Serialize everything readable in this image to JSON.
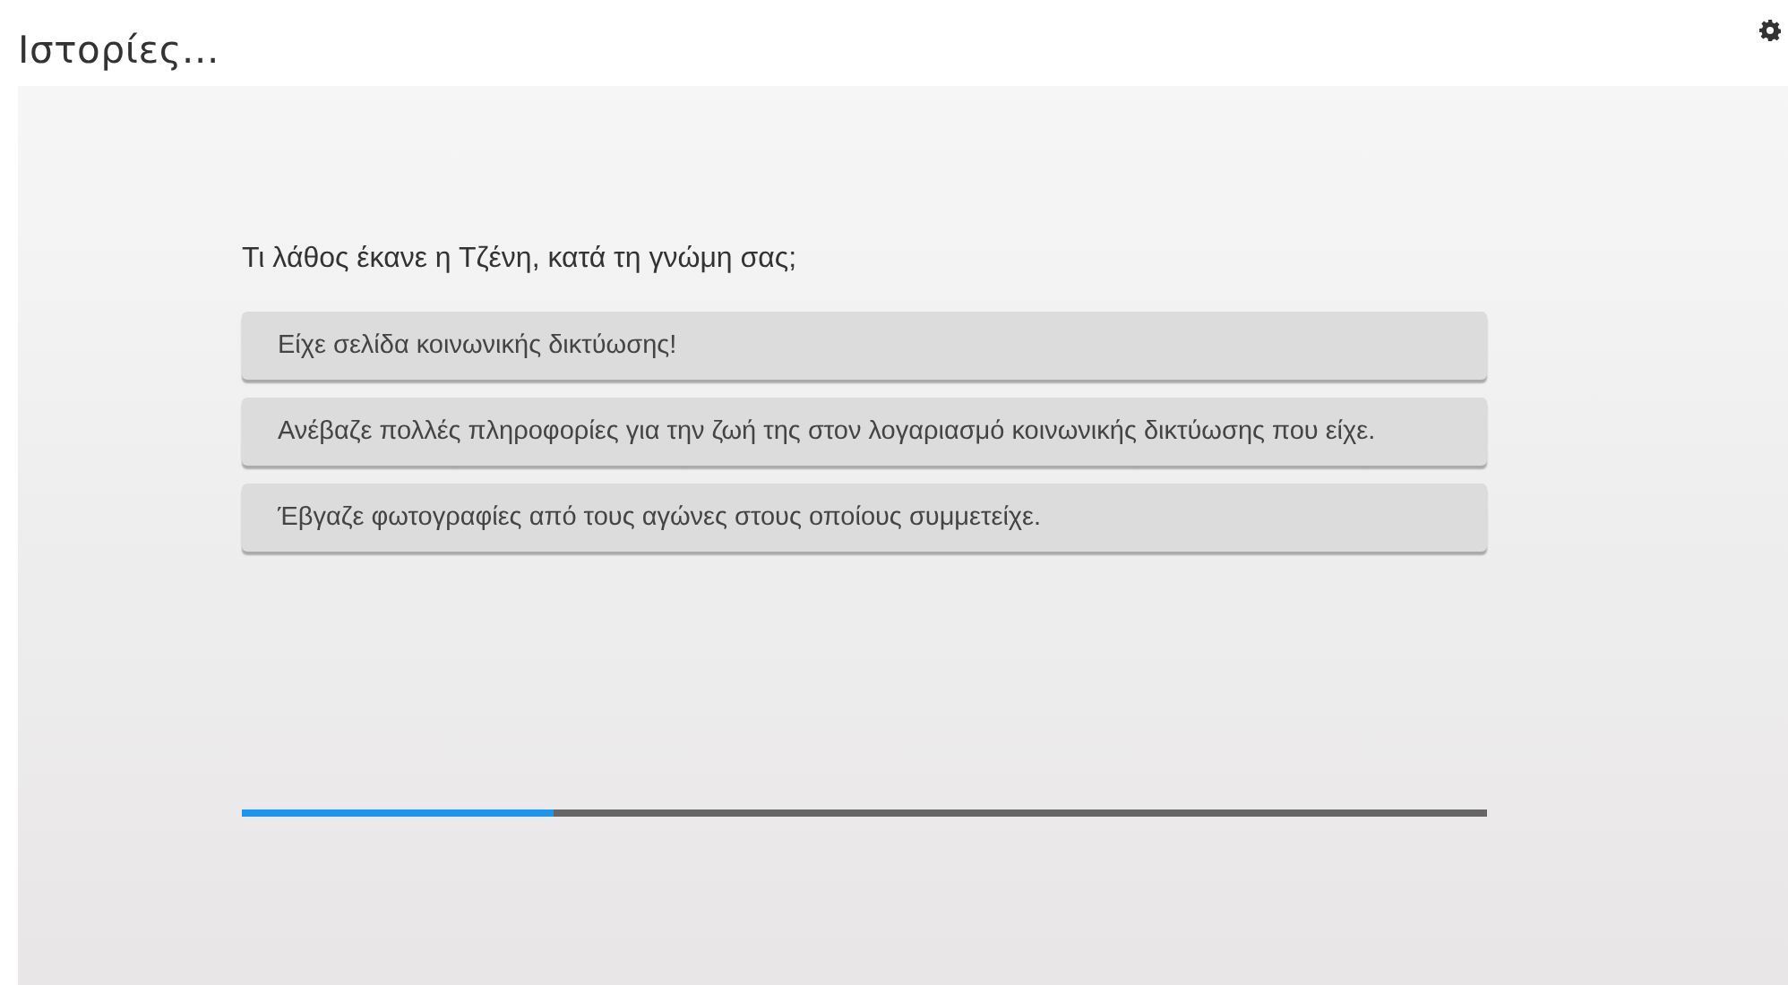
{
  "title": "Ιστορίες...",
  "question": "Τι λάθος έκανε η Τζένη, κατά τη γνώμη σας;",
  "options": [
    {
      "label": "Είχε σελίδα κοινωνικής δικτύωσης!"
    },
    {
      "label": "Ανέβαζε πολλές πληροφορίες για την ζωή της στον λογαριασμό κοινωνικής δικτύωσης που είχε."
    },
    {
      "label": "Έβγαζε φωτογραφίες από τους αγώνες στους οποίους συμμετείχε."
    }
  ],
  "progress": {
    "level": 0.25
  }
}
